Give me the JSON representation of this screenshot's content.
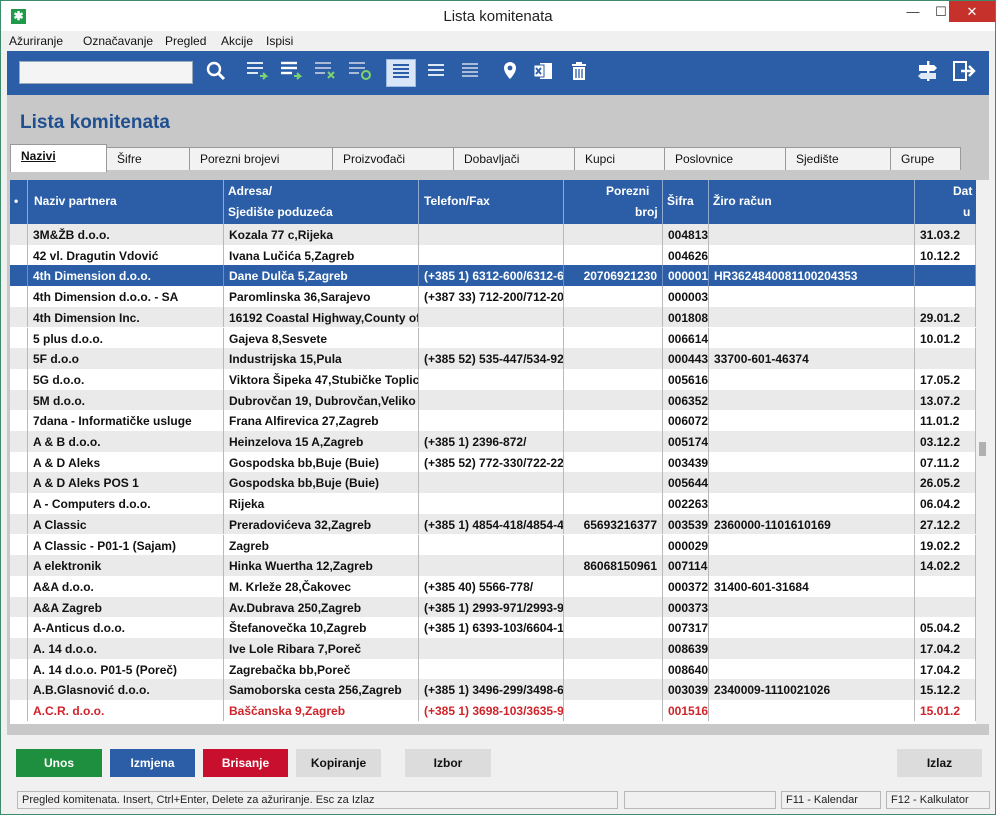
{
  "window": {
    "title": "Lista komitenata",
    "app_icon": "app-icon",
    "min": "—",
    "max": "☐",
    "close": "✕"
  },
  "menu": [
    "Ažuriranje",
    "Označavanje",
    "Pregled",
    "Akcije",
    "Ispisi"
  ],
  "toolbar": {
    "search_value": "",
    "icons": [
      "search-icon",
      "add-row-icon",
      "insert-row-icon",
      "delete-row-icon",
      "refresh-rows-icon",
      "view-list-icon",
      "view-compact-icon",
      "view-dense-icon",
      "location-icon",
      "excel-icon",
      "trash-icon",
      "signpost-icon",
      "exit-icon"
    ]
  },
  "page": {
    "heading": "Lista komitenata"
  },
  "tabs": [
    "Nazivi",
    "Šifre",
    "Porezni brojevi",
    "Proizvođači",
    "Dobavljači",
    "Kupci",
    "Poslovnice",
    "Sjedište",
    "Grupe"
  ],
  "columns": {
    "marker": "•",
    "naziv": "Naziv partnera",
    "adresa1": "Adresa/",
    "adresa2": "Sjedište poduzeća",
    "telefon": "Telefon/Fax",
    "porezni1": "Porezni",
    "porezni2": "broj",
    "sifra": "Šifra",
    "ziro": "Žiro račun",
    "dat1": "Dat",
    "dat2": "u"
  },
  "rows": [
    {
      "naziv": "3M&ŽB d.o.o.",
      "adresa": "Kozala 77 c,Rijeka",
      "telefon": "",
      "porezni": "",
      "sifra": "004813",
      "ziro": "",
      "datum": "31.03.2"
    },
    {
      "naziv": "42 vl. Dragutin Vdović",
      "adresa": "Ivana Lučića 5,Zagreb",
      "telefon": "",
      "porezni": "",
      "sifra": "004626",
      "ziro": "",
      "datum": "10.12.2"
    },
    {
      "naziv": "4th Dimension d.o.o.",
      "adresa": "Dane Dulča 5,Zagreb",
      "telefon": "(+385 1) 6312-600/6312-6",
      "porezni": "20706921230",
      "sifra": "000001",
      "ziro": "HR3624840081100204353",
      "datum": ""
    },
    {
      "naziv": "4th Dimension d.o.o. - SA",
      "adresa": "Paromlinska 36,Sarajevo",
      "telefon": "(+387 33) 712-200/712-20",
      "porezni": "",
      "sifra": "000003",
      "ziro": "",
      "datum": ""
    },
    {
      "naziv": "4th Dimension Inc.",
      "adresa": "16192 Coastal Highway,County of",
      "telefon": "",
      "porezni": "",
      "sifra": "001808",
      "ziro": "",
      "datum": "29.01.2"
    },
    {
      "naziv": "5 plus d.o.o.",
      "adresa": "Gajeva 8,Sesvete",
      "telefon": "",
      "porezni": "",
      "sifra": "006614",
      "ziro": "",
      "datum": "10.01.2"
    },
    {
      "naziv": "5F d.o.o",
      "adresa": "Industrijska 15,Pula",
      "telefon": "(+385 52) 535-447/534-92",
      "porezni": "",
      "sifra": "000443",
      "ziro": "33700-601-46374",
      "datum": ""
    },
    {
      "naziv": "5G d.o.o.",
      "adresa": "Viktora Šipeka 47,Stubičke Toplice",
      "telefon": "",
      "porezni": "",
      "sifra": "005616",
      "ziro": "",
      "datum": "17.05.2"
    },
    {
      "naziv": "5M d.o.o.",
      "adresa": "Dubrovčan 19, Dubrovčan,Veliko T",
      "telefon": "",
      "porezni": "",
      "sifra": "006352",
      "ziro": "",
      "datum": "13.07.2"
    },
    {
      "naziv": "7dana - Informatičke usluge",
      "adresa": "Frana Alfirevica 27,Zagreb",
      "telefon": "",
      "porezni": "",
      "sifra": "006072",
      "ziro": "",
      "datum": "11.01.2"
    },
    {
      "naziv": "A & B d.o.o.",
      "adresa": "Heinzelova 15 A,Zagreb",
      "telefon": "(+385 1) 2396-872/",
      "porezni": "",
      "sifra": "005174",
      "ziro": "",
      "datum": "03.12.2"
    },
    {
      "naziv": "A & D Aleks",
      "adresa": "Gospodska bb,Buje (Buie)",
      "telefon": "(+385 52) 772-330/722-22",
      "porezni": "",
      "sifra": "003439",
      "ziro": "",
      "datum": "07.11.2"
    },
    {
      "naziv": "A & D Aleks POS 1",
      "adresa": "Gospodska bb,Buje (Buie)",
      "telefon": "",
      "porezni": "",
      "sifra": "005644",
      "ziro": "",
      "datum": "26.05.2"
    },
    {
      "naziv": "A - Computers d.o.o.",
      "adresa": "Rijeka",
      "telefon": "",
      "porezni": "",
      "sifra": "002263",
      "ziro": "",
      "datum": "06.04.2"
    },
    {
      "naziv": "A Classic",
      "adresa": "Preradovićeva 32,Zagreb",
      "telefon": "(+385 1) 4854-418/4854-4",
      "porezni": "65693216377",
      "sifra": "003539",
      "ziro": "2360000-1101610169",
      "datum": "27.12.2"
    },
    {
      "naziv": "A Classic - P01-1 (Sajam)",
      "adresa": "Zagreb",
      "telefon": "",
      "porezni": "",
      "sifra": "000029",
      "ziro": "",
      "datum": "19.02.2"
    },
    {
      "naziv": "A elektronik",
      "adresa": "Hinka Wuertha 12,Zagreb",
      "telefon": "",
      "porezni": "86068150961",
      "sifra": "007114",
      "ziro": "",
      "datum": "14.02.2"
    },
    {
      "naziv": "A&A d.o.o.",
      "adresa": "M. Krleže 28,Čakovec",
      "telefon": "(+385 40) 5566-778/",
      "porezni": "",
      "sifra": "000372",
      "ziro": "31400-601-31684",
      "datum": ""
    },
    {
      "naziv": "A&A Zagreb",
      "adresa": "Av.Dubrava 250,Zagreb",
      "telefon": "(+385 1) 2993-971/2993-9",
      "porezni": "",
      "sifra": "000373",
      "ziro": "",
      "datum": ""
    },
    {
      "naziv": "A-Anticus d.o.o.",
      "adresa": "Štefanovečka 10,Zagreb",
      "telefon": "(+385 1) 6393-103/6604-1",
      "porezni": "",
      "sifra": "007317",
      "ziro": "",
      "datum": "05.04.2"
    },
    {
      "naziv": "A. 14 d.o.o.",
      "adresa": "Ive Lole Ribara 7,Poreč",
      "telefon": "",
      "porezni": "",
      "sifra": "008639",
      "ziro": "",
      "datum": "17.04.2"
    },
    {
      "naziv": "A. 14 d.o.o. P01-5 (Poreč)",
      "adresa": "Zagrebačka bb,Poreč",
      "telefon": "",
      "porezni": "",
      "sifra": "008640",
      "ziro": "",
      "datum": "17.04.2"
    },
    {
      "naziv": "A.B.Glasnović d.o.o.",
      "adresa": "Samoborska cesta 256,Zagreb",
      "telefon": "(+385 1) 3496-299/3498-6",
      "porezni": "",
      "sifra": "003039",
      "ziro": "2340009-1110021026",
      "datum": "15.12.2"
    },
    {
      "naziv": "A.C.R. d.o.o.",
      "adresa": "Baščanska 9,Zagreb",
      "telefon": "(+385 1) 3698-103/3635-9",
      "porezni": "",
      "sifra": "001516",
      "ziro": "",
      "datum": "15.01.2"
    }
  ],
  "buttons": {
    "unos": "Unos",
    "izmjena": "Izmjena",
    "brisanje": "Brisanje",
    "kopiranje": "Kopiranje",
    "izbor": "Izbor",
    "izlaz": "Izlaz"
  },
  "colors": {
    "green": "#1e8f3e",
    "blue": "#2b5ea6",
    "red": "#c8102e"
  },
  "status": {
    "message": "Pregled komitenata. Insert, Ctrl+Enter, Delete za ažuriranje. Esc za Izlaz",
    "blank": "",
    "f11": "F11 - Kalendar",
    "f12": "F12 - Kalkulator"
  }
}
